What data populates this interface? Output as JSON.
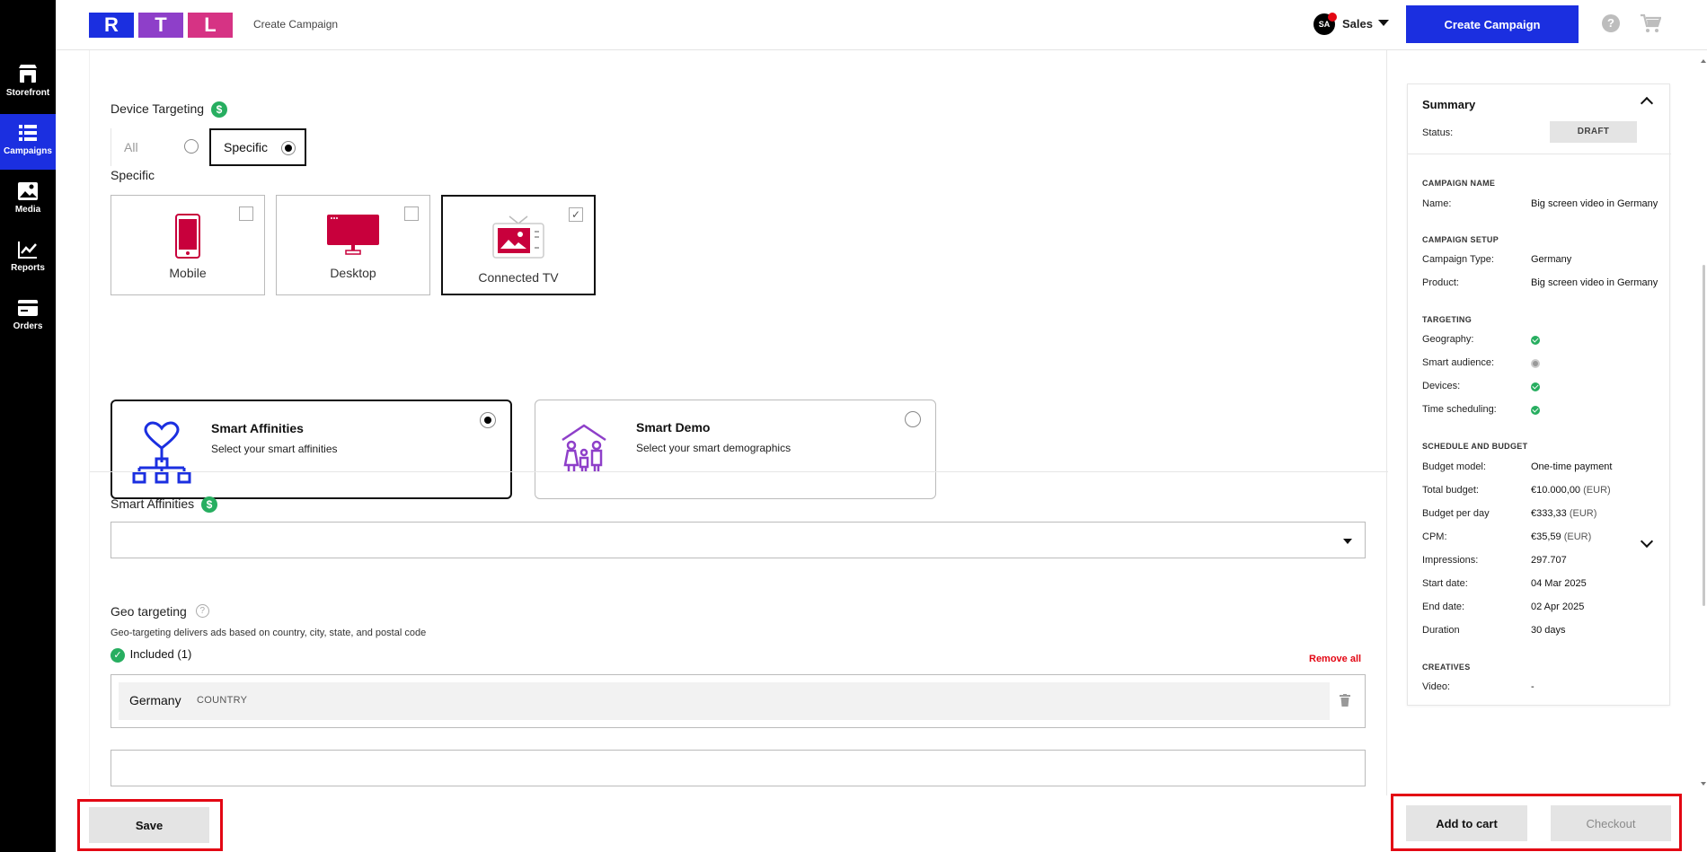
{
  "nav": [
    {
      "label": "Storefront",
      "icon": "storefront-icon"
    },
    {
      "label": "Campaigns",
      "icon": "campaigns-icon"
    },
    {
      "label": "Media",
      "icon": "media-icon"
    },
    {
      "label": "Reports",
      "icon": "reports-icon"
    },
    {
      "label": "Orders",
      "icon": "orders-icon"
    }
  ],
  "header": {
    "logo": [
      "R",
      "T",
      "L"
    ],
    "logo_colors": [
      "#1b2fe0",
      "#8e3fc9",
      "#d63384"
    ],
    "breadcrumb": "Create Campaign",
    "avatar": "SA",
    "user": "Sales",
    "create_button": "Create Campaign",
    "help": "?"
  },
  "device_targeting": {
    "label": "Device Targeting",
    "dollar": "$",
    "options": [
      "All",
      "Specific"
    ],
    "selected": "Specific",
    "specific_label": "Specific",
    "devices": [
      {
        "label": "Mobile",
        "checked": false
      },
      {
        "label": "Desktop",
        "checked": false
      },
      {
        "label": "Connected TV",
        "checked": true
      }
    ],
    "check_mark": "✓"
  },
  "smart_cards": [
    {
      "title": "Smart Affinities",
      "subtitle": "Select your smart affinities",
      "selected": true
    },
    {
      "title": "Smart Demo",
      "subtitle": "Select your smart demographics",
      "selected": false
    }
  ],
  "smart_affinities": {
    "label": "Smart Affinities",
    "dollar": "$",
    "value": ""
  },
  "geo": {
    "label": "Geo targeting",
    "help": "?",
    "description": "Geo-targeting delivers ads based on country, city, state, and postal code",
    "included_check": "✓",
    "included": "Included (1)",
    "remove_all": "Remove all",
    "items": [
      {
        "name": "Germany",
        "type": "COUNTRY"
      }
    ],
    "input_value": ""
  },
  "summary": {
    "title": "Summary",
    "status_label": "Status:",
    "status": "DRAFT",
    "sections": {
      "campaign_name": "CAMPAIGN NAME",
      "campaign_setup": "CAMPAIGN SETUP",
      "targeting": "TARGETING",
      "schedule": "SCHEDULE AND BUDGET",
      "creatives": "CREATIVES"
    },
    "name_label": "Name:",
    "name": "Big screen video in Germany",
    "type_label": "Campaign Type:",
    "type": "Germany",
    "product_label": "Product:",
    "product": "Big screen video in Germany",
    "targeting": [
      {
        "label": "Geography:",
        "state": "ok"
      },
      {
        "label": "Smart audience:",
        "state": "pending"
      },
      {
        "label": "Devices:",
        "state": "ok"
      },
      {
        "label": "Time scheduling:",
        "state": "ok"
      }
    ],
    "budget_model_label": "Budget model:",
    "budget_model": "One-time payment",
    "total_budget_label": "Total budget:",
    "total_budget": "€10.000,00",
    "budget_day_label": "Budget per day",
    "budget_day": "€333,33",
    "cpm_label": "CPM:",
    "cpm": "€35,59",
    "currency": "(EUR)",
    "impressions_label": "Impressions:",
    "impressions": "297.707",
    "start_label": "Start date:",
    "start": "04 Mar 2025",
    "end_label": "End date:",
    "end": "02 Apr 2025",
    "duration_label": "Duration",
    "duration": "30 days",
    "video_label": "Video:",
    "video": "-"
  },
  "footer": {
    "save": "Save",
    "add_to_cart": "Add to cart",
    "checkout": "Checkout"
  },
  "colors": {
    "primary": "#1b2fe0",
    "accent": "#e30613",
    "success": "#27ae60",
    "tv": "#c8003c"
  }
}
